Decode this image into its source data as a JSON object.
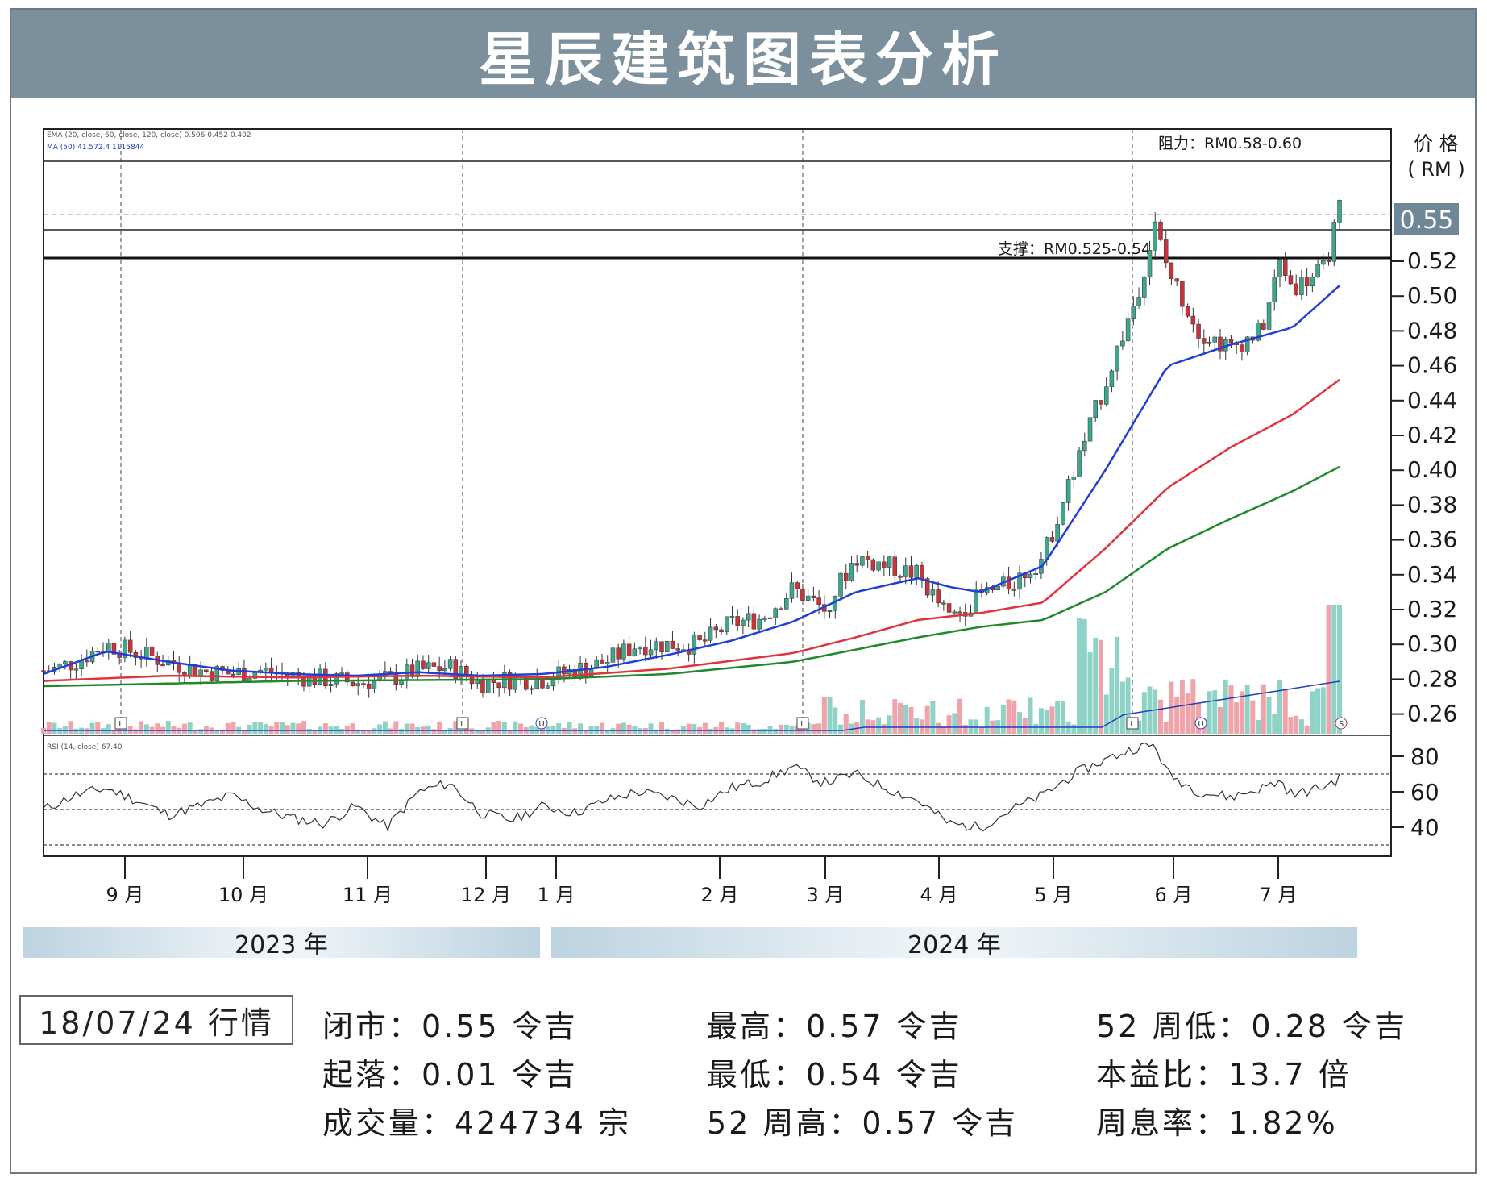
{
  "title": "星辰建筑图表分析",
  "legend_text": {
    "ema": "EMA (20, close, 60, close, 120, close)  0.506  0.452  0.402",
    "ma": "MA (50)  41.572.4  1115844",
    "rsi": "RSI (14, close) 67.40"
  },
  "resistance_label": "阻力：RM0.58-0.60",
  "support_label": "支撑：RM0.525-0.54",
  "axis_title": {
    "line1": "价 格",
    "line2": "( RM )"
  },
  "last_price": "0.55",
  "volume_markers": [
    "L",
    "L",
    "U",
    "L",
    "L",
    "U",
    "S"
  ],
  "years": [
    "2023 年",
    "2024 年"
  ],
  "quote": {
    "date": "18/07/24 行情",
    "close": "闭市：0.55 令吉",
    "change": "起落：0.01 令吉",
    "volume": "成交量：424734 宗",
    "high": "最高：0.57 令吉",
    "low": "最低：0.54 令吉",
    "high52": "52 周高：0.57 令吉",
    "low52": "52 周低：0.28 令吉",
    "pe": "本益比：13.7 倍",
    "yield": "周息率：1.82%"
  },
  "colors": {
    "title_bg": "#7b909c",
    "ema20": "#1f3fd6",
    "ema60": "#e0333f",
    "ema120": "#1f8a2a",
    "candle_up": "#3fa58c",
    "candle_down": "#c9343a",
    "vol_up": "#8fd3c7",
    "vol_down": "#f0a3a8"
  },
  "chart_data": {
    "type": "candlestick",
    "y_ticks": [
      0.26,
      0.28,
      0.3,
      0.32,
      0.34,
      0.36,
      0.38,
      0.4,
      0.42,
      0.44,
      0.46,
      0.48,
      0.5,
      0.52
    ],
    "x_tick_labels": [
      "9 月",
      "10 月",
      "11 月",
      "12 月",
      "1 月",
      "2 月",
      "3 月",
      "4 月",
      "5 月",
      "6 月",
      "7 月"
    ],
    "rsi_ticks": [
      80,
      60,
      40
    ],
    "resistance_range": [
      0.58,
      0.6
    ],
    "support_range": [
      0.525,
      0.54
    ],
    "close_points": [
      [
        0,
        0.285
      ],
      [
        0.1,
        0.285
      ],
      [
        0.5,
        0.29
      ],
      [
        1,
        0.3
      ],
      [
        1.5,
        0.295
      ],
      [
        2,
        0.29
      ],
      [
        2.5,
        0.285
      ],
      [
        3,
        0.283
      ],
      [
        3.5,
        0.285
      ],
      [
        4,
        0.282
      ],
      [
        4.5,
        0.28
      ],
      [
        5,
        0.278
      ],
      [
        5.5,
        0.28
      ],
      [
        6,
        0.285
      ],
      [
        6.5,
        0.287
      ],
      [
        7,
        0.278
      ],
      [
        7.5,
        0.28
      ],
      [
        8,
        0.28
      ],
      [
        8.5,
        0.285
      ],
      [
        9,
        0.29
      ],
      [
        9.5,
        0.3
      ],
      [
        10,
        0.3
      ],
      [
        10.5,
        0.3
      ],
      [
        11,
        0.312
      ],
      [
        11.5,
        0.315
      ],
      [
        12,
        0.332
      ],
      [
        12.5,
        0.32
      ],
      [
        13,
        0.35
      ],
      [
        13.5,
        0.345
      ],
      [
        14,
        0.34
      ],
      [
        14.5,
        0.315
      ],
      [
        15,
        0.328
      ],
      [
        15.5,
        0.335
      ],
      [
        16,
        0.35
      ],
      [
        16.5,
        0.4
      ],
      [
        17,
        0.45
      ],
      [
        17.5,
        0.5
      ],
      [
        17.8,
        0.54
      ],
      [
        18,
        0.515
      ],
      [
        18.5,
        0.48
      ],
      [
        19,
        0.47
      ],
      [
        19.5,
        0.48
      ],
      [
        19.8,
        0.52
      ],
      [
        20,
        0.505
      ],
      [
        20.5,
        0.515
      ],
      [
        20.75,
        0.55
      ]
    ],
    "ema20_points": [
      [
        0,
        0.283
      ],
      [
        1,
        0.296
      ],
      [
        2,
        0.29
      ],
      [
        3,
        0.285
      ],
      [
        4,
        0.283
      ],
      [
        5,
        0.282
      ],
      [
        6,
        0.284
      ],
      [
        7,
        0.282
      ],
      [
        8,
        0.283
      ],
      [
        9,
        0.287
      ],
      [
        10,
        0.294
      ],
      [
        11,
        0.302
      ],
      [
        12,
        0.313
      ],
      [
        13,
        0.33
      ],
      [
        14,
        0.338
      ],
      [
        14.5,
        0.333
      ],
      [
        15,
        0.33
      ],
      [
        16,
        0.345
      ],
      [
        17,
        0.4
      ],
      [
        18,
        0.46
      ],
      [
        19,
        0.472
      ],
      [
        20,
        0.482
      ],
      [
        20.75,
        0.506
      ]
    ],
    "ema60_points": [
      [
        0,
        0.279
      ],
      [
        2,
        0.282
      ],
      [
        4,
        0.281
      ],
      [
        6,
        0.282
      ],
      [
        8,
        0.281
      ],
      [
        10,
        0.286
      ],
      [
        12,
        0.295
      ],
      [
        13,
        0.304
      ],
      [
        14,
        0.314
      ],
      [
        15,
        0.318
      ],
      [
        16,
        0.324
      ],
      [
        17,
        0.355
      ],
      [
        18,
        0.39
      ],
      [
        19,
        0.413
      ],
      [
        20,
        0.432
      ],
      [
        20.75,
        0.452
      ]
    ],
    "ema120_points": [
      [
        0,
        0.276
      ],
      [
        4,
        0.279
      ],
      [
        8,
        0.28
      ],
      [
        10,
        0.283
      ],
      [
        12,
        0.29
      ],
      [
        13,
        0.297
      ],
      [
        14,
        0.304
      ],
      [
        15,
        0.31
      ],
      [
        16,
        0.314
      ],
      [
        17,
        0.33
      ],
      [
        18,
        0.355
      ],
      [
        19,
        0.372
      ],
      [
        20,
        0.388
      ],
      [
        20.75,
        0.402
      ]
    ],
    "rsi_points": [
      [
        0,
        50
      ],
      [
        0.5,
        58
      ],
      [
        1,
        62
      ],
      [
        1.5,
        55
      ],
      [
        2,
        47
      ],
      [
        2.5,
        52
      ],
      [
        3,
        58
      ],
      [
        3.5,
        50
      ],
      [
        4,
        45
      ],
      [
        4.5,
        42
      ],
      [
        5,
        52
      ],
      [
        5.5,
        40
      ],
      [
        6,
        60
      ],
      [
        6.5,
        65
      ],
      [
        7,
        48
      ],
      [
        7.5,
        44
      ],
      [
        8,
        52
      ],
      [
        8.5,
        48
      ],
      [
        9,
        55
      ],
      [
        9.5,
        60
      ],
      [
        10,
        57
      ],
      [
        10.5,
        52
      ],
      [
        11,
        62
      ],
      [
        11.5,
        66
      ],
      [
        12,
        74
      ],
      [
        12.5,
        65
      ],
      [
        13,
        70
      ],
      [
        13.5,
        62
      ],
      [
        14,
        55
      ],
      [
        14.5,
        42
      ],
      [
        15,
        40
      ],
      [
        15.5,
        50
      ],
      [
        16,
        58
      ],
      [
        16.5,
        70
      ],
      [
        17,
        78
      ],
      [
        17.5,
        85
      ],
      [
        17.8,
        86
      ],
      [
        18,
        70
      ],
      [
        18.5,
        60
      ],
      [
        19,
        57
      ],
      [
        19.5,
        62
      ],
      [
        19.8,
        66
      ],
      [
        20,
        58
      ],
      [
        20.5,
        63
      ],
      [
        20.75,
        67.4
      ]
    ]
  }
}
